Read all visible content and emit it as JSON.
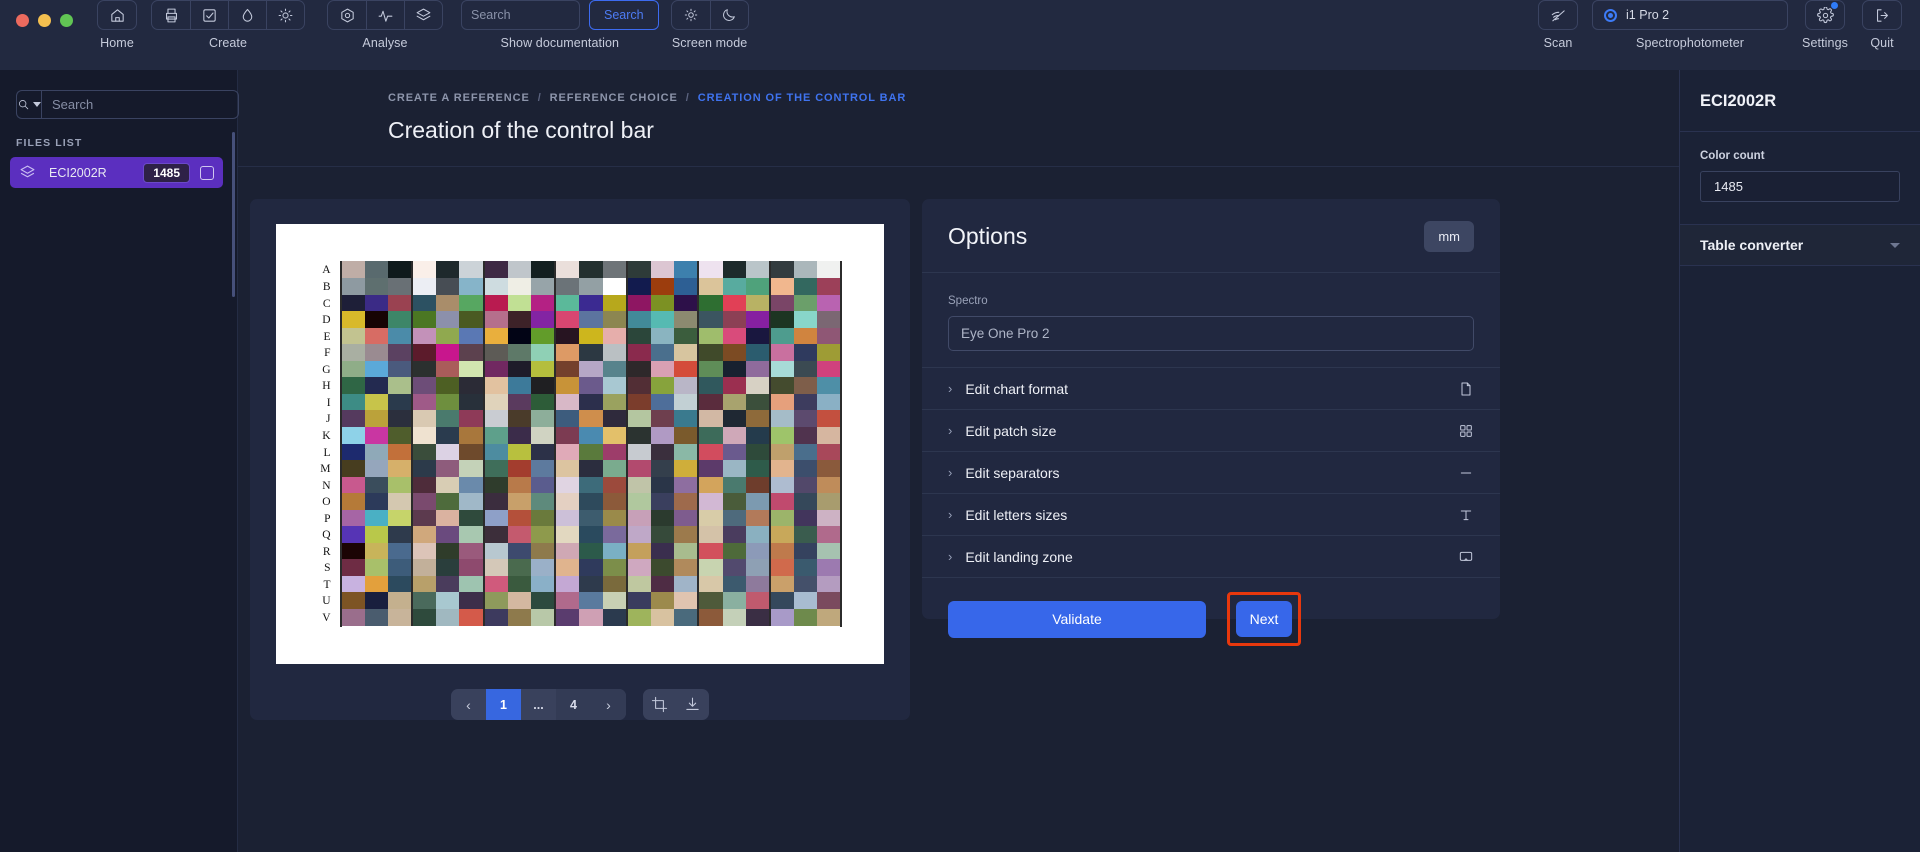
{
  "window": {
    "traffic_lights": [
      "#ec6a5e",
      "#f4bf4f",
      "#61c554"
    ]
  },
  "toolbar": {
    "groups": [
      {
        "label": "Home",
        "icons": [
          "home-icon"
        ]
      },
      {
        "label": "Create",
        "icons": [
          "printer-icon",
          "checkbox-task-icon",
          "droplet-icon",
          "sun-icon"
        ]
      },
      {
        "label": "Analyse",
        "icons": [
          "target-icon",
          "pulse-icon",
          "layers-icon"
        ]
      }
    ],
    "search_placeholder": "Search",
    "search_button": "Search",
    "documentation_label": "Show documentation",
    "screen_mode_label": "Screen mode",
    "screen_mode_icons": [
      "sun-icon",
      "moon-icon"
    ],
    "scan_label": "Scan",
    "scan_icon": "scan-off-icon",
    "spectro_device": "i1 Pro 2",
    "spectrophotometer_label": "Spectrophotometer",
    "settings_label": "Settings",
    "settings_icon": "gear-icon",
    "quit_label": "Quit",
    "quit_icon": "exit-icon"
  },
  "sidebar": {
    "search_placeholder": "Search",
    "files_list_title": "FILES LIST",
    "files": [
      {
        "name": "ECI2002R",
        "count": "1485",
        "selected": true
      }
    ]
  },
  "breadcrumb": {
    "items": [
      "CREATE A REFERENCE",
      "REFERENCE CHOICE",
      "CREATION OF THE CONTROL BAR"
    ],
    "separator": "/",
    "current_index": 2
  },
  "page": {
    "title": "Creation of the control bar"
  },
  "preview": {
    "row_letters": [
      "A",
      "B",
      "C",
      "D",
      "E",
      "F",
      "G",
      "H",
      "I",
      "J",
      "K",
      "L",
      "M",
      "N",
      "O",
      "P",
      "Q",
      "R",
      "S",
      "T",
      "U",
      "V"
    ],
    "pagination": {
      "prev": "‹",
      "pages": [
        "1",
        "...",
        "4"
      ],
      "next": "›",
      "active_page": "1"
    },
    "tools": [
      "crop-icon",
      "download-icon"
    ]
  },
  "options": {
    "title": "Options",
    "unit_button": "mm",
    "spectro_label": "Spectro",
    "spectro_value": "Eye One Pro 2",
    "rows": [
      {
        "label": "Edit chart format",
        "icon": "document-icon"
      },
      {
        "label": "Edit patch size",
        "icon": "grid-four-icon"
      },
      {
        "label": "Edit separators",
        "icon": "minus-icon"
      },
      {
        "label": "Edit letters sizes",
        "icon": "text-t-icon"
      },
      {
        "label": "Edit landing zone",
        "icon": "landing-zone-icon"
      }
    ],
    "validate_button": "Validate",
    "next_button": "Next",
    "next_highlight_color": "#e8380d"
  },
  "right_panel": {
    "title": "ECI2002R",
    "color_count_label": "Color count",
    "color_count_value": "1485",
    "table_converter_label": "Table converter"
  },
  "colors": {
    "accent": "#3767ea",
    "sidebar_selected": "#5b2fbf",
    "topbar_bg": "#222940",
    "panel_bg": "#212840"
  },
  "chart_data": {
    "type": "heatmap",
    "title": "ECI2002R control bar patch chart",
    "rows": 22,
    "columns": 21,
    "grid": [
      [
        "#bfada6",
        "#596a6e",
        "#0f1a1c",
        "#faefe9",
        "#1e292c",
        "#ccd3d8",
        "#3e2944",
        "#c0c6cb",
        "#131f20",
        "#eadfdb",
        "#23302f",
        "#6e7478",
        "#2e3b39",
        "#dcc6d2",
        "#3d80ad",
        "#eee2ef",
        "#1d2a2b",
        "#bac5c9",
        "#333c3f",
        "#abb7bb",
        "#f0f1f0"
      ],
      [
        "#8e9aa1",
        "#5e6f6f",
        "#697075",
        "#eceef4",
        "#474d54",
        "#86b4c9",
        "#cedce0",
        "#efeee5",
        "#97a4a9",
        "#6b7378",
        "#93a0a4",
        "#ffffff",
        "#121b4e",
        "#9c3d0d",
        "#2d5f94",
        "#dbc49a",
        "#58ab9f",
        "#4fa27b",
        "#f1b78e",
        "#33685f",
        "#9c4059"
      ],
      [
        "#1e1f38",
        "#3b2b86",
        "#9a4251",
        "#2c5162",
        "#a98d6a",
        "#57a761",
        "#b91b50",
        "#c1e094",
        "#b42184",
        "#5bb99a",
        "#3b2a91",
        "#b7a81c",
        "#8e1662",
        "#7c9123",
        "#2d1049",
        "#2e6e31",
        "#e14056",
        "#b8b264",
        "#7a4567",
        "#6b9f6a",
        "#b963b1"
      ],
      [
        "#d8b92a",
        "#170404",
        "#3d8668",
        "#4b7723",
        "#8c90ab",
        "#4a5a22",
        "#b56f8c",
        "#3d2228",
        "#8324a3",
        "#d84671",
        "#5c749f",
        "#8c8651",
        "#428a99",
        "#56bab2",
        "#8c8a70",
        "#3b5560",
        "#8c4055",
        "#8620a1",
        "#1d3522",
        "#88d6c9",
        "#7b6773"
      ],
      [
        "#c2c390",
        "#d76c64",
        "#4b8ba9",
        "#c391b9",
        "#90a94f",
        "#5a78b4",
        "#e9af3d",
        "#020415",
        "#629c2a",
        "#271421",
        "#cdb61d",
        "#e6aeab",
        "#2b463a",
        "#8ab4c0",
        "#3b5d3d",
        "#9fbd6c",
        "#d94b7b",
        "#19173f",
        "#4e9c8e",
        "#d0843f",
        "#8f5775"
      ],
      [
        "#a9afa2",
        "#9a8b91",
        "#5b4161",
        "#5c1b2b",
        "#c8168d",
        "#5c414e",
        "#5d5b56",
        "#5e7968",
        "#8fd0b5",
        "#dd9a65",
        "#2c3842",
        "#bac0c3",
        "#8a2a4d",
        "#4a6f8d",
        "#d7c59f",
        "#404a2a",
        "#7c4b23",
        "#2b5c6e",
        "#c9709f",
        "#2f3a5e",
        "#9e9c35"
      ],
      [
        "#8fad88",
        "#5ba9d9",
        "#4a5a7d",
        "#2b302f",
        "#aa5c5a",
        "#d2e5b0",
        "#712861",
        "#1e1c2a",
        "#b4be3d",
        "#74402c",
        "#b6a7c6",
        "#57838c",
        "#2e282a",
        "#d9a0b3",
        "#d44c3a",
        "#5f8d58",
        "#182130",
        "#8f6b9c",
        "#a7dbd7",
        "#3b4a52",
        "#d0417d"
      ],
      [
        "#2f6645",
        "#232a50",
        "#aabf8b",
        "#6d4d78",
        "#4d5f23",
        "#2b2b36",
        "#e2c2a0",
        "#3d7a9a",
        "#1f1f22",
        "#c89338",
        "#6b5a8c",
        "#a8c8d2",
        "#522e35",
        "#87a33c",
        "#b9b6c7",
        "#30585d",
        "#9b2f50",
        "#d7d1c4",
        "#444b2e",
        "#7e5e4a",
        "#4e8fa7"
      ],
      [
        "#3d8c85",
        "#c7c44a",
        "#2a3a4c",
        "#9f5a88",
        "#6e8f3e",
        "#28303a",
        "#e0d3bb",
        "#5a3a5e",
        "#2d5c38",
        "#d8b8c7",
        "#2c2f4c",
        "#9aa25f",
        "#7b3d2c",
        "#4e6e9a",
        "#c2d0d4",
        "#5a2c3d",
        "#a8a36e",
        "#3b4f3b",
        "#e6a07c",
        "#3d3c5e",
        "#8ab0c5"
      ],
      [
        "#553a5e",
        "#bba23a",
        "#2b2f3d",
        "#d9c9b2",
        "#4a7a6d",
        "#8e3a58",
        "#c9ccd2",
        "#4a3b2a",
        "#8dae9a",
        "#3d5c7d",
        "#cf8e4c",
        "#2f2a3c",
        "#b4c6a0",
        "#6e3f4e",
        "#3a7a8e",
        "#d2b8a4",
        "#1f2833",
        "#8e6a3a",
        "#a5bcc8",
        "#5c4a6e",
        "#c3503f"
      ],
      [
        "#8ed2e8",
        "#c936a2",
        "#4f5d2c",
        "#efe2d0",
        "#2a3b4e",
        "#a8773c",
        "#5ea08b",
        "#3b2c4a",
        "#d0d3c2",
        "#7c3b52",
        "#4a8ab0",
        "#e3c06a",
        "#2b3330",
        "#b09ac4",
        "#7a5a2c",
        "#3d6b5a",
        "#cfa8b8",
        "#243b4c",
        "#9ec46a",
        "#50334e",
        "#d6b6a0"
      ],
      [
        "#1d2a6e",
        "#8fa9b8",
        "#c2703a",
        "#3a4d3b",
        "#dcd2e4",
        "#6e4a2c",
        "#4d8ca0",
        "#b8c03e",
        "#2c3148",
        "#e0aab8",
        "#5a7a3c",
        "#9d3d6a",
        "#c7cbd0",
        "#3a2f3d",
        "#8ab8a6",
        "#d24c5e",
        "#6a5a8e",
        "#2e4a3a",
        "#bfa06c",
        "#4a6e8c",
        "#a8485a"
      ],
      [
        "#473d1f",
        "#95a6bc",
        "#d6b06a",
        "#2c3a4a",
        "#8e5c7c",
        "#c4d2b8",
        "#3f6e5a",
        "#a33d2e",
        "#5d7a9e",
        "#dcc4a0",
        "#2b2d3e",
        "#7aab8e",
        "#b24a6e",
        "#343f4c",
        "#cfae3a",
        "#5c3a6a",
        "#9ab6c4",
        "#2e5b4a",
        "#e2b48e",
        "#3c4e6c",
        "#8a5a3c"
      ],
      [
        "#c8598e",
        "#3a4d5c",
        "#a8c06a",
        "#4e2c3a",
        "#d8cdb4",
        "#6a8aab",
        "#2f3c2c",
        "#b87a4a",
        "#5a5c8e",
        "#e0d4e2",
        "#3d6b7a",
        "#9c4a3c",
        "#c0c4a8",
        "#2a3548",
        "#8e6ea0",
        "#d3a45c",
        "#4a7a6e",
        "#6e3d2c",
        "#aebcd0",
        "#52486a",
        "#bf8c5a"
      ],
      [
        "#b57a38",
        "#2c3a5a",
        "#d4c8b0",
        "#7a4a6e",
        "#4e6b3c",
        "#a0b8c8",
        "#3b2d3e",
        "#c8a06a",
        "#5e8a7c",
        "#e4d0c2",
        "#2e4a5c",
        "#8c5a3a",
        "#b0c89e",
        "#3a3f5e",
        "#9e6a4c",
        "#d2b8d4",
        "#4a5c3a",
        "#7c9ab0",
        "#c04a6e",
        "#35485a",
        "#a89c6e"
      ],
      [
        "#a665a5",
        "#4ab0c4",
        "#c6d46a",
        "#5c3a4e",
        "#dab2a0",
        "#2f4a3c",
        "#8ea0c8",
        "#b4503a",
        "#6a7a3c",
        "#ccc0d8",
        "#3d5c6e",
        "#9a8a4a",
        "#c7a0b8",
        "#2b3a2e",
        "#7e5c8e",
        "#d8cca8",
        "#4e6a7c",
        "#b27a5a",
        "#9cb46a",
        "#42355c",
        "#cdb2c4"
      ],
      [
        "#5634b5",
        "#b9c84a",
        "#2e3a4c",
        "#d0a87c",
        "#6a4a7e",
        "#a8c8b0",
        "#3c2e3a",
        "#c45a6e",
        "#8e9a4c",
        "#e2d8c0",
        "#2a4a5e",
        "#7a6a9c",
        "#bfa8c8",
        "#364a3a",
        "#9c7a4c",
        "#d4c2a8",
        "#4a3c5e",
        "#8ab0c0",
        "#c8a85a",
        "#3a5c4e",
        "#b06a8c"
      ],
      [
        "#1b0404",
        "#c8b45a",
        "#4a6a8e",
        "#dcc4b8",
        "#2f3c2a",
        "#9a5a7c",
        "#b8c8d0",
        "#3d4a6e",
        "#8e7a4c",
        "#cfa8b4",
        "#2c5a4a",
        "#7ab0c4",
        "#c4a05c",
        "#3a2e4e",
        "#a8bc8e",
        "#d2505c",
        "#4e6a3a",
        "#8c9ab8",
        "#bf7a4c",
        "#35425e",
        "#a6c2b0"
      ],
      [
        "#6e2c44",
        "#a8c06a",
        "#3d5c7a",
        "#c2b09a",
        "#2a3e3c",
        "#8e4a6e",
        "#d4c8b8",
        "#4a6a4e",
        "#9ab0c8",
        "#e0b48e",
        "#2f3a5c",
        "#7c8e4a",
        "#cfa8c0",
        "#3c4a2e",
        "#b08a5c",
        "#c8d4b0",
        "#524a6e",
        "#8ea0b4",
        "#d06a4c",
        "#3a5a6e",
        "#9c7ab0"
      ],
      [
        "#c8b2e0",
        "#e3a03c",
        "#2c4a5e",
        "#b8a06a",
        "#4a3c5c",
        "#9ec4b0",
        "#d05a7c",
        "#3a5a3e",
        "#8ab0c8",
        "#c4a8d4",
        "#2e3a4c",
        "#7a6a3c",
        "#bfc8a0",
        "#4e2c44",
        "#a0b4c8",
        "#d8c8a8",
        "#3c5a6e",
        "#8e7a9c",
        "#caa06a",
        "#44506a",
        "#b49cc0"
      ],
      [
        "#7d5424",
        "#191f3e",
        "#c4b08e",
        "#4a6a5c",
        "#a8c8d0",
        "#3d2e4a",
        "#8e9a5c",
        "#d4b8a0",
        "#2c4a3e",
        "#b06a8c",
        "#5a7a9e",
        "#c8d0b4",
        "#3a3c5e",
        "#9c8a4c",
        "#e0c4b0",
        "#4e5a3a",
        "#8ab0a0",
        "#c05a6e",
        "#35485c",
        "#a8bcd0",
        "#7a4a5e"
      ],
      [
        "#9a6e8c",
        "#4a5c6e",
        "#c8b49a",
        "#2e4a3c",
        "#a0b8c0",
        "#d45a4a",
        "#3d3a5e",
        "#8e7a4c",
        "#b8c8a8",
        "#5a3c6e",
        "#cfa0b4",
        "#2b3a4e",
        "#9eb45c",
        "#d8c2a0",
        "#4a6a7c",
        "#8c5a3a",
        "#c4d0b8",
        "#3a2e44",
        "#a89ac8",
        "#6e8a4c",
        "#bfa87c"
      ]
    ]
  }
}
